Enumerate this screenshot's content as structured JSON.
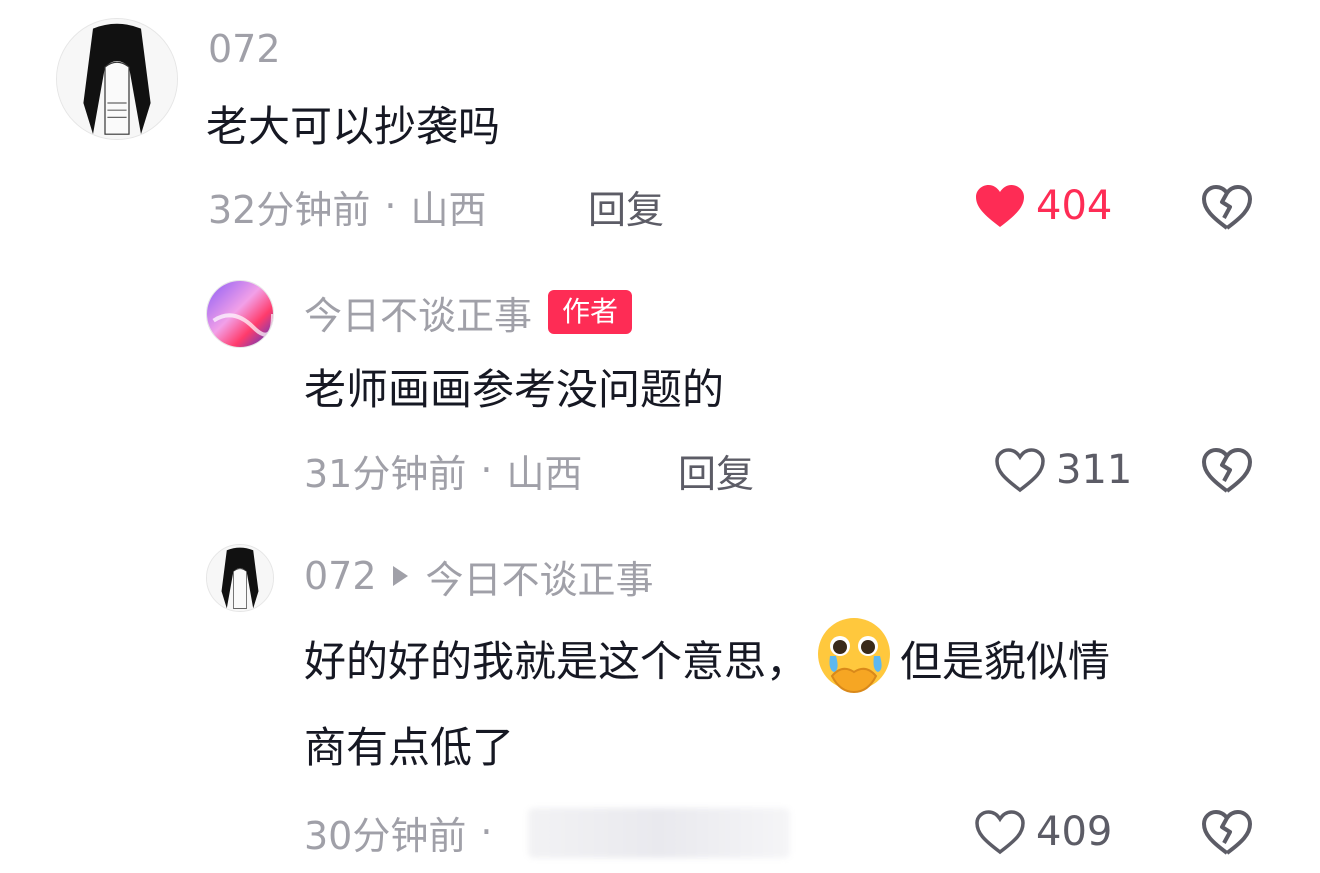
{
  "comments": [
    {
      "username": "072",
      "text": "老大可以抄袭吗",
      "time": "32分钟前",
      "location": "山西",
      "reply_label": "回复",
      "likes": "404",
      "liked": true
    },
    {
      "username": "今日不谈正事",
      "author_badge": "作者",
      "text": "老师画画参考没问题的",
      "time": "31分钟前",
      "location": "山西",
      "reply_label": "回复",
      "likes": "311",
      "liked": false
    },
    {
      "username": "072",
      "reply_to": "今日不谈正事",
      "text_line1_a": "好的好的我就是这个意思，",
      "text_line1_b": "但是貌似情",
      "text_line2": "商有点低了",
      "emoji": "crying-face-emoji",
      "time": "30分钟前",
      "likes": "409",
      "liked": false
    }
  ],
  "colors": {
    "accent": "#fe2c55",
    "muted": "#a0a0a8",
    "text": "#161823"
  }
}
